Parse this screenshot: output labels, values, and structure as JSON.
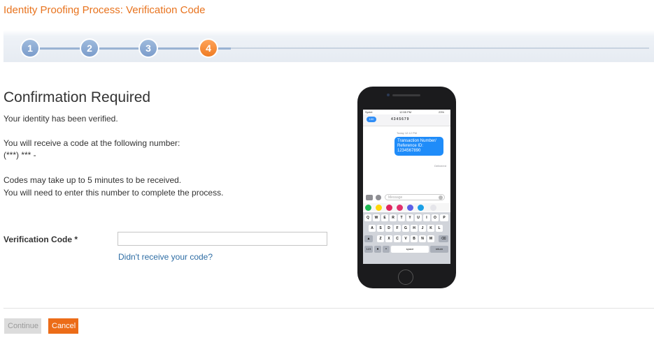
{
  "header": {
    "title": "Identity Proofing Process: Verification Code"
  },
  "progress": {
    "steps": [
      "1",
      "2",
      "3",
      "4"
    ],
    "current_step": 4
  },
  "content": {
    "heading": "Confirmation Required",
    "verified_text": "Your identity has been verified.",
    "receive_text": "You will receive a code at the following number:",
    "masked_number": "(***) *** -",
    "delay_text": "Codes may take up to 5 minutes to be received.",
    "enter_text": "You will need to enter this number to complete the process."
  },
  "form": {
    "code_label": "Verification Code *",
    "code_value": "",
    "resend_link": "Didn't receive your code?"
  },
  "phone": {
    "carrier": "Sprint",
    "time": "12:55 PM",
    "battery": "23%",
    "back_label": "100",
    "contact": "4345679",
    "message_time": "Today 12:12 PM",
    "message_lines": [
      "Transaction Number/",
      "Reference ID:",
      "1234567890"
    ],
    "delivered": "Delivered",
    "input_placeholder": "Message",
    "keyboard_rows": [
      [
        "Q",
        "W",
        "E",
        "R",
        "T",
        "Y",
        "U",
        "I",
        "O",
        "P"
      ],
      [
        "A",
        "S",
        "D",
        "F",
        "G",
        "H",
        "J",
        "K",
        "L"
      ],
      [
        "Z",
        "X",
        "C",
        "V",
        "B",
        "N",
        "M"
      ]
    ],
    "key_123": "123",
    "key_space": "space",
    "key_return": "return"
  },
  "footer": {
    "continue_label": "Continue",
    "cancel_label": "Cancel"
  },
  "colors": {
    "accent": "#e8731e",
    "step_done": "#7b9ccb",
    "step_active": "#ef7b22",
    "link": "#2e6da4"
  }
}
